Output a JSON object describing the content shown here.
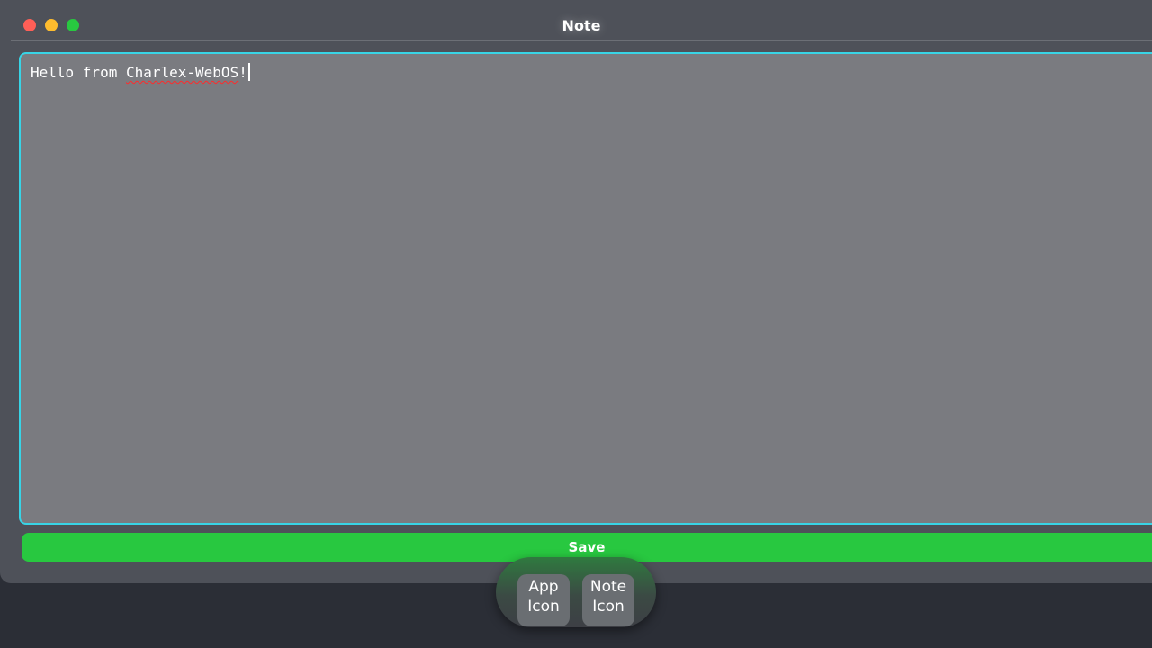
{
  "window": {
    "title": "Note",
    "controls": [
      "close",
      "minimize",
      "maximize"
    ],
    "colors": {
      "close": "#ff5f57",
      "minimize": "#febc2e",
      "maximize": "#28c840"
    }
  },
  "editor": {
    "text_prefix": "Hello from ",
    "text_misspelled": "Charlex-WebOS",
    "text_suffix": "!",
    "focus_border_color": "#38d4e6"
  },
  "actions": {
    "save_label": "Save",
    "save_color": "#28c840"
  },
  "dock": {
    "items": [
      {
        "line1": "App",
        "line2": "Icon"
      },
      {
        "line1": "Note",
        "line2": "Icon"
      }
    ]
  }
}
